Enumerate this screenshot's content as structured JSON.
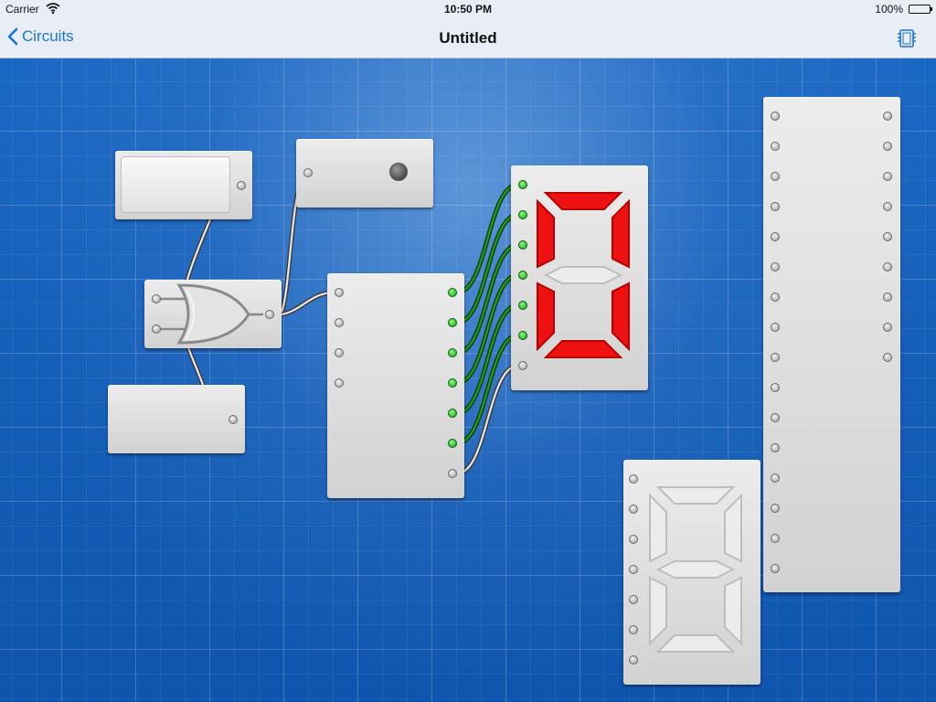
{
  "status_bar": {
    "carrier": "Carrier",
    "time": "10:50 PM",
    "battery": "100%",
    "battery_level": 1.0
  },
  "nav": {
    "back_label": "Circuits",
    "title": "Untitled",
    "right_icon": "chip-icon"
  },
  "colors": {
    "accent": "#1a72d8",
    "wire_on": "#1aa01a",
    "wire_off": "#e8e8e8",
    "segment_on": "#ee1111",
    "segment_off": "#bdbdbd"
  },
  "components": {
    "switch_top": {
      "type": "toggle-switch"
    },
    "switch_bottom": {
      "type": "toggle-switch"
    },
    "or_gate": {
      "type": "or-gate"
    },
    "light": {
      "type": "led-bulb",
      "lit": false
    },
    "decoder": {
      "type": "decoder",
      "outputs": [
        true,
        true,
        true,
        true,
        true,
        true,
        false
      ]
    },
    "display_lit": {
      "type": "seven-segment",
      "segments": [
        true,
        true,
        true,
        true,
        true,
        true,
        false
      ]
    },
    "display_off": {
      "type": "seven-segment",
      "segments": [
        false,
        false,
        false,
        false,
        false,
        false,
        false
      ]
    },
    "ic_chip": {
      "type": "ic"
    }
  }
}
